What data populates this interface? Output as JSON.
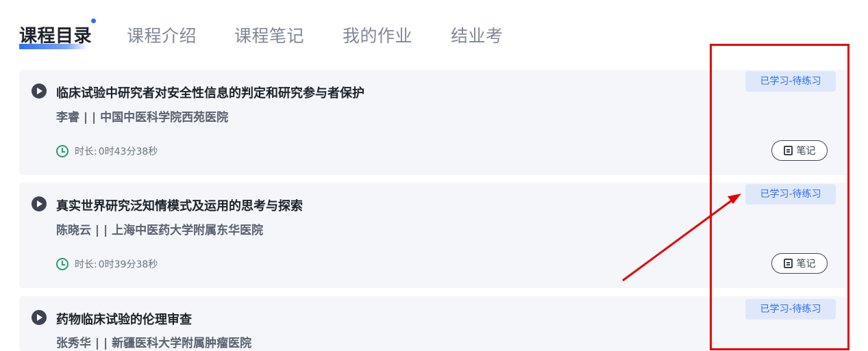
{
  "tabs": [
    {
      "label": "课程目录",
      "active": true
    },
    {
      "label": "课程介绍"
    },
    {
      "label": "课程笔记"
    },
    {
      "label": "我的作业"
    },
    {
      "label": "结业考"
    }
  ],
  "courses": [
    {
      "title": "临床试验中研究者对安全性信息的判定和研究参与者保护",
      "teacher": "李睿 | | 中国中医科学院西苑医院",
      "duration_label": "时长:",
      "duration": "0时43分38秒",
      "status": "已学习-待练习",
      "note_label": "笔记"
    },
    {
      "title": "真实世界研究泛知情模式及运用的思考与探索",
      "teacher": "陈晓云 | | 上海中医药大学附属东华医院",
      "duration_label": "时长:",
      "duration": "0时39分38秒",
      "status": "已学习-待练习",
      "note_label": "笔记"
    },
    {
      "title": "药物临床试验的伦理审查",
      "teacher": "张秀华 | | 新疆医科大学附属肿瘤医院",
      "status": "已学习-待练习"
    }
  ],
  "colors": {
    "accent": "#2b6ef6",
    "status_bg": "#dfe8fb",
    "card_bg": "#f4f6fa",
    "clock": "#22a06b",
    "annotation": "#e60000"
  },
  "icons": [
    "play-icon",
    "clock-icon",
    "note-icon"
  ]
}
